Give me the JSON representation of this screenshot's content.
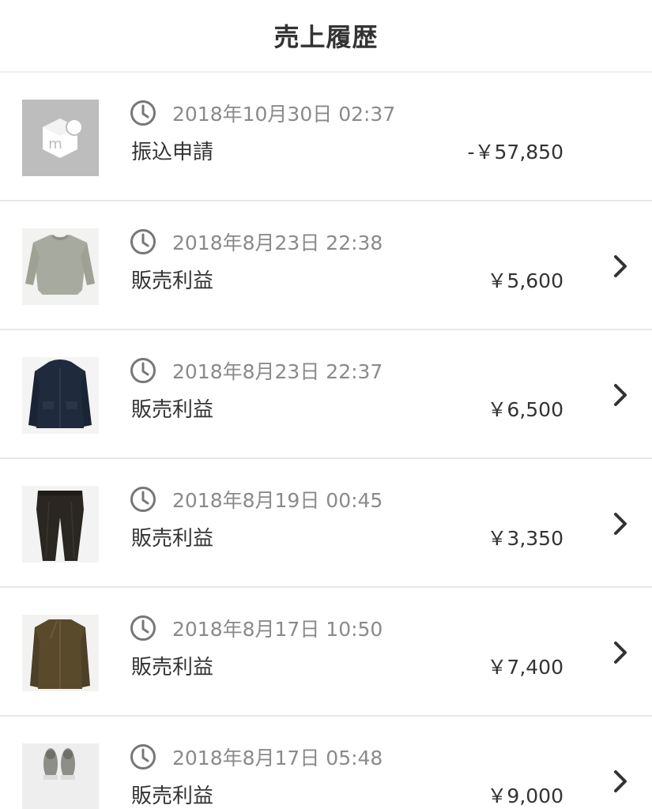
{
  "header": {
    "title": "売上履歴"
  },
  "history": [
    {
      "datetime": "2018年10月30日 02:37",
      "type": "振込申請",
      "amount": "-￥57,850",
      "thumbnail": "mercari-logo",
      "chevron": false
    },
    {
      "datetime": "2018年8月23日 22:38",
      "type": "販売利益",
      "amount": "￥5,600",
      "thumbnail": "grey-knit-sweater",
      "chevron": true
    },
    {
      "datetime": "2018年8月23日 22:37",
      "type": "販売利益",
      "amount": "￥6,500",
      "thumbnail": "navy-jacket",
      "chevron": true
    },
    {
      "datetime": "2018年8月19日 00:45",
      "type": "販売利益",
      "amount": "￥3,350",
      "thumbnail": "black-trousers",
      "chevron": true
    },
    {
      "datetime": "2018年8月17日 10:50",
      "type": "販売利益",
      "amount": "￥7,400",
      "thumbnail": "brown-shirt-jacket",
      "chevron": true
    },
    {
      "datetime": "2018年8月17日 05:48",
      "type": "販売利益",
      "amount": "￥9,000",
      "thumbnail": "grey-sneakers",
      "chevron": true
    }
  ],
  "colors": {
    "text": "#333333",
    "time_text": "#8a8a8a",
    "divider": "#e8e8e8",
    "icon": "#777777"
  },
  "icons": {
    "time": "clock-icon",
    "detail": "chevron-right-icon"
  }
}
